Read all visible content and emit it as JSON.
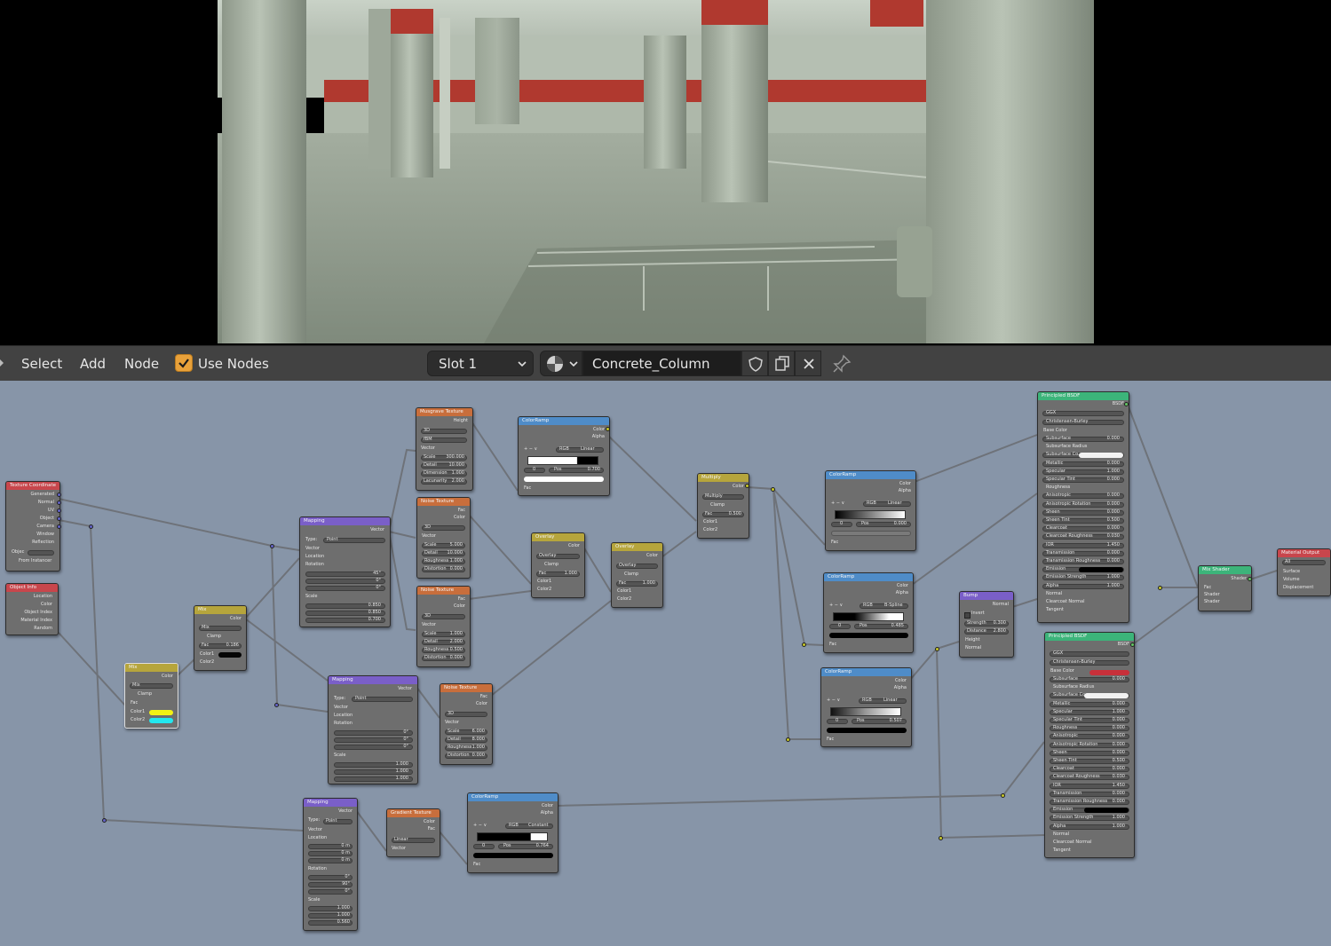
{
  "header": {
    "menus": [
      "Select",
      "Add",
      "Node"
    ],
    "use_nodes_label": "Use Nodes",
    "use_nodes_checked": true,
    "slot": "Slot 1",
    "material_name": "Concrete_Column"
  },
  "colors": {
    "editor_bg": "#8795a8",
    "header_bg": "#424242",
    "accent_check": "#e8a13a",
    "node_body": "#6e6e6e",
    "hdr_input": "#c8464c",
    "hdr_texture": "#c86e3c",
    "hdr_converter": "#4f8cc8",
    "hdr_color": "#b6a53c",
    "hdr_vector": "#7a5fc8",
    "hdr_shader": "#3cb47a",
    "hdr_output": "#c8464c"
  },
  "nodes": {
    "texcoord": {
      "title": "Texture Coordinate",
      "rows": [
        "Generated",
        "Normal",
        "UV",
        "Object",
        "Camera",
        "Window",
        "Reflection"
      ],
      "object_label": "Objec",
      "from_instancer": "From Instancer"
    },
    "objinfo": {
      "title": "Object Info",
      "rows": [
        "Location",
        "Color",
        "Object Index",
        "Material Index",
        "Random"
      ]
    },
    "mix_small": {
      "title": "Mix",
      "out": "Color",
      "mode": "Mix",
      "clamp": "Clamp",
      "fac": "Fac",
      "c1": "Color1",
      "c2": "Color2"
    },
    "mix2": {
      "title": "Mix",
      "out": "Color",
      "mode": "Mix",
      "clamp": "Clamp",
      "fac": "Fac",
      "fac_val": "0.186",
      "c1": "Color1",
      "c2": "Color2"
    },
    "mapping1": {
      "title": "Mapping",
      "out": "Vector",
      "type_lbl": "Type:",
      "type": "Point",
      "vector": "Vector",
      "location": "Location",
      "rotation": "Rotation",
      "scale": "Scale",
      "rx": "45°",
      "ry": "0°",
      "rz": "0°",
      "sx": "0.850",
      "sy": "0.850",
      "sz": "0.700"
    },
    "mapping2": {
      "title": "Mapping",
      "out": "Vector",
      "type_lbl": "Type:",
      "type": "Point",
      "vector": "Vector",
      "location": "Location",
      "rotation": "Rotation",
      "scale": "Scale",
      "rx": "0°",
      "ry": "0°",
      "rz": "0°",
      "sx": "1.000",
      "sy": "1.000",
      "sz": "1.000"
    },
    "mapping3": {
      "title": "Mapping",
      "out": "Vector",
      "type_lbl": "Type:",
      "type": "Point",
      "vector": "Vector",
      "location": "Location",
      "lx": "0 m",
      "ly": "0 m",
      "lz": "0 m",
      "rotation": "Rotation",
      "rx": "0°",
      "ry": "90°",
      "rz": "0°",
      "scale": "Scale",
      "sx": "1.000",
      "sy": "1.000",
      "sz": "0.560"
    },
    "musgrave": {
      "title": "Musgrave Texture",
      "out": "Height",
      "dim": "3D",
      "kind": "fBM",
      "vector": "Vector",
      "scale": "Scale",
      "scale_v": "300.000",
      "detail": "Detail",
      "detail_v": "10.000",
      "dimension": "Dimension",
      "dimension_v": "1.000",
      "lacunarity": "Lacunarity",
      "lacunarity_v": "2.000"
    },
    "noise1": {
      "title": "Noise Texture",
      "fac": "Fac",
      "color": "Color",
      "dim": "3D",
      "vector": "Vector",
      "scale": "Scale",
      "scale_v": "5.000",
      "detail": "Detail",
      "detail_v": "10.000",
      "roughness": "Roughness",
      "roughness_v": "1.000",
      "distortion": "Distortion",
      "distortion_v": "0.000"
    },
    "noise2": {
      "title": "Noise Texture",
      "fac": "Fac",
      "color": "Color",
      "dim": "3D",
      "vector": "Vector",
      "scale": "Scale",
      "scale_v": "1.000",
      "detail": "Detail",
      "detail_v": "2.000",
      "roughness": "Roughness",
      "roughness_v": "0.500",
      "distortion": "Distortion",
      "distortion_v": "0.000"
    },
    "noise3": {
      "title": "Noise Texture",
      "fac": "Fac",
      "color": "Color",
      "dim": "3D",
      "vector": "Vector",
      "scale": "Scale",
      "scale_v": "6.000",
      "detail": "Detail",
      "detail_v": "8.000",
      "roughness": "Roughness",
      "roughness_v": "1.000",
      "distortion": "Distortion",
      "distortion_v": "0.000"
    },
    "gradient": {
      "title": "Gradient Texture",
      "color": "Color",
      "fac": "Fac",
      "type": "Linear",
      "vector": "Vector"
    },
    "ramp1": {
      "title": "ColorRamp",
      "color": "Color",
      "alpha": "Alpha",
      "mode": "RGB",
      "interp": "Linear",
      "idx": "0",
      "pos_lbl": "Pos",
      "pos": "0.700",
      "fac": "Fac"
    },
    "ramp2": {
      "title": "ColorRamp",
      "color": "Color",
      "alpha": "Alpha",
      "mode": "RGB",
      "interp": "Linear",
      "idx": "0",
      "pos_lbl": "Pos",
      "pos": "0.000",
      "fac": "Fac"
    },
    "ramp3": {
      "title": "ColorRamp",
      "color": "Color",
      "alpha": "Alpha",
      "mode": "RGB",
      "interp": "B-Spline",
      "idx": "0",
      "pos_lbl": "Pos",
      "pos": "0.485",
      "fac": "Fac"
    },
    "ramp4": {
      "title": "ColorRamp",
      "color": "Color",
      "alpha": "Alpha",
      "mode": "RGB",
      "interp": "Linear",
      "idx": "0",
      "pos_lbl": "Pos",
      "pos": "0.507",
      "fac": "Fac"
    },
    "ramp5": {
      "title": "ColorRamp",
      "color": "Color",
      "alpha": "Alpha",
      "mode": "RGB",
      "interp": "Constant",
      "idx": "0",
      "pos_lbl": "Pos",
      "pos": "0.764",
      "fac": "Fac"
    },
    "overlay1": {
      "title": "Overlay",
      "out": "Color",
      "mode": "Overlay",
      "clamp": "Clamp",
      "fac": "Fac",
      "fac_v": "1.000",
      "c1": "Color1",
      "c2": "Color2"
    },
    "overlay2": {
      "title": "Overlay",
      "out": "Color",
      "mode": "Overlay",
      "clamp": "Clamp",
      "fac": "Fac",
      "fac_v": "1.000",
      "c1": "Color1",
      "c2": "Color2"
    },
    "multiply": {
      "title": "Multiply",
      "out": "Color",
      "mode": "Multiply",
      "clamp": "Clamp",
      "fac": "Fac",
      "fac_v": "0.500",
      "c1": "Color1",
      "c2": "Color2"
    },
    "bump": {
      "title": "Bump",
      "out": "Normal",
      "invert": "Invert",
      "strength": "Strength",
      "strength_v": "0.300",
      "distance": "Distance",
      "distance_v": "2.800",
      "height": "Height",
      "normal": "Normal"
    },
    "bsdf1": {
      "title": "Principled BSDF",
      "out": "BSDF",
      "dist": "GGX",
      "sss": "Christensen-Burley",
      "base": "Base Color",
      "rows": [
        [
          "Subsurface",
          "0.000"
        ],
        [
          "Subsurface Radius",
          ""
        ],
        [
          "Subsurface Co...",
          ""
        ],
        [
          "Metallic",
          "0.000"
        ],
        [
          "Specular",
          "1.000"
        ],
        [
          "Specular Tint",
          "0.000"
        ],
        [
          "Roughness",
          ""
        ],
        [
          "Anisotropic",
          "0.000"
        ],
        [
          "Anisotropic Rotation",
          "0.000"
        ],
        [
          "Sheen",
          "0.000"
        ],
        [
          "Sheen Tint",
          "0.500"
        ],
        [
          "Clearcoat",
          "0.000"
        ],
        [
          "Clearcoat Roughness",
          "0.030"
        ],
        [
          "IOR",
          "1.450"
        ],
        [
          "Transmission",
          "0.000"
        ],
        [
          "Transmission Roughness",
          "0.000"
        ],
        [
          "Emission",
          ""
        ],
        [
          "Emission Strength",
          "1.000"
        ],
        [
          "Alpha",
          "1.000"
        ],
        [
          "Normal",
          ""
        ],
        [
          "Clearcoat Normal",
          ""
        ],
        [
          "Tangent",
          ""
        ]
      ]
    },
    "bsdf2": {
      "title": "Principled BSDF",
      "out": "BSDF",
      "dist": "GGX",
      "sss": "Christensen-Burley",
      "base": "Base Color",
      "rows": [
        [
          "Subsurface",
          "0.000"
        ],
        [
          "Subsurface Radius",
          ""
        ],
        [
          "Subsurface Co...",
          ""
        ],
        [
          "Metallic",
          "0.000"
        ],
        [
          "Specular",
          "1.000"
        ],
        [
          "Specular Tint",
          "0.000"
        ],
        [
          "Roughness",
          "0.000"
        ],
        [
          "Anisotropic",
          "0.000"
        ],
        [
          "Anisotropic Rotation",
          "0.000"
        ],
        [
          "Sheen",
          "0.000"
        ],
        [
          "Sheen Tint",
          "0.500"
        ],
        [
          "Clearcoat",
          "0.000"
        ],
        [
          "Clearcoat Roughness",
          "0.030"
        ],
        [
          "IOR",
          "1.450"
        ],
        [
          "Transmission",
          "0.000"
        ],
        [
          "Transmission Roughness",
          "0.000"
        ],
        [
          "Emission",
          ""
        ],
        [
          "Emission Strength",
          "1.000"
        ],
        [
          "Alpha",
          "1.000"
        ],
        [
          "Normal",
          ""
        ],
        [
          "Clearcoat Normal",
          ""
        ],
        [
          "Tangent",
          ""
        ]
      ]
    },
    "mixshader": {
      "title": "Mix Shader",
      "out": "Shader",
      "fac": "Fac",
      "s1": "Shader",
      "s2": "Shader"
    },
    "output": {
      "title": "Material Output",
      "target": "All",
      "surface": "Surface",
      "volume": "Volume",
      "displacement": "Displacement"
    }
  }
}
